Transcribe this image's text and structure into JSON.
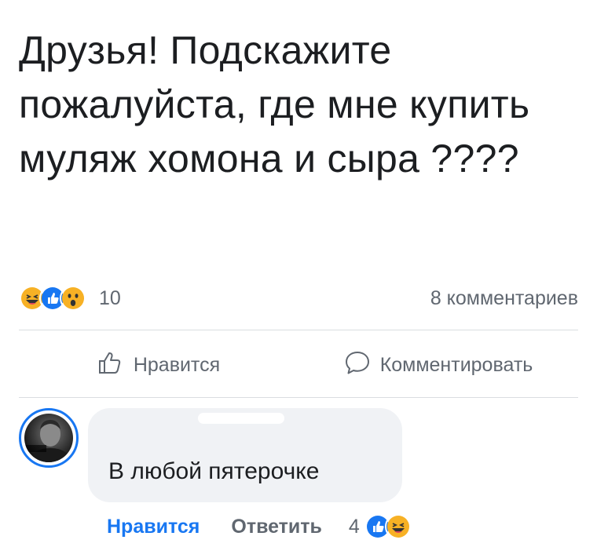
{
  "post": {
    "text": "Друзья! Подскажите пожалуйста, где мне купить муляж хомона и сыра  ????"
  },
  "stats": {
    "reaction_icons": [
      "haha-icon",
      "like-icon",
      "wow-icon"
    ],
    "reaction_count": "10",
    "comments_count": "8 комментариев"
  },
  "actions": {
    "like_label": "Нравится",
    "comment_label": "Комментировать"
  },
  "comment": {
    "text": "В любой пятерочке",
    "like_label": "Нравится",
    "reply_label": "Ответить",
    "reaction_count": "4",
    "reaction_icons": [
      "like-icon",
      "haha-icon"
    ]
  },
  "colors": {
    "accent": "#1877f2",
    "secondary_text": "#606770",
    "bubble_bg": "#f0f2f5",
    "haha": "#f7b125",
    "like": "#1877f2"
  }
}
